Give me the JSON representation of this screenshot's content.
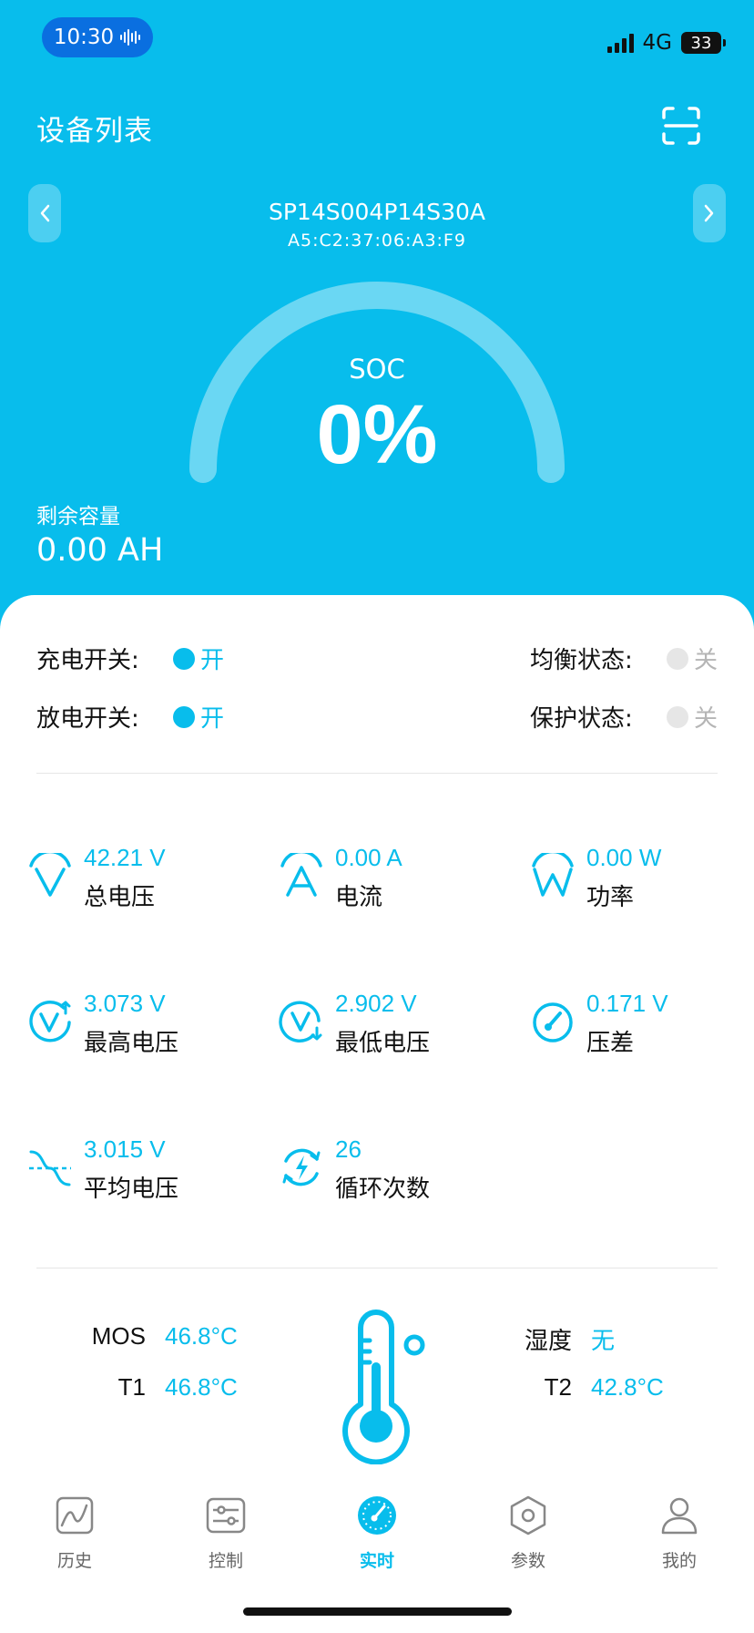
{
  "status_bar": {
    "time": "10:30",
    "network": "4G",
    "battery": "33"
  },
  "header": {
    "title": "设备列表",
    "device_name": "SP14S004P14S30A",
    "device_mac": "A5:C2:37:06:A3:F9"
  },
  "gauge": {
    "label": "SOC",
    "value": "0%",
    "fraction": 0
  },
  "capacity": {
    "label": "剩余容量",
    "value": "0.00 AH"
  },
  "switches": {
    "charge": {
      "label": "充电开关:",
      "state": "开"
    },
    "discharge": {
      "label": "放电开关:",
      "state": "开"
    },
    "balance": {
      "label": "均衡状态:",
      "state": "关"
    },
    "protect": {
      "label": "保护状态:",
      "state": "关"
    }
  },
  "metrics": {
    "total_voltage": {
      "value": "42.21 V",
      "label": "总电压"
    },
    "current": {
      "value": "0.00 A",
      "label": "电流"
    },
    "power": {
      "value": "0.00 W",
      "label": "功率"
    },
    "max_voltage": {
      "value": "3.073 V",
      "label": "最高电压"
    },
    "min_voltage": {
      "value": "2.902 V",
      "label": "最低电压"
    },
    "voltage_diff": {
      "value": "0.171 V",
      "label": "压差"
    },
    "avg_voltage": {
      "value": "3.015 V",
      "label": "平均电压"
    },
    "cycles": {
      "value": "26",
      "label": "循环次数"
    }
  },
  "temps": {
    "mos": {
      "label": "MOS",
      "value": "46.8°C"
    },
    "t1": {
      "label": "T1",
      "value": "46.8°C"
    },
    "humidity": {
      "label": "湿度",
      "value": "无"
    },
    "t2": {
      "label": "T2",
      "value": "42.8°C"
    }
  },
  "bottom_nav": [
    {
      "label": "历史",
      "icon": "history-chart-icon"
    },
    {
      "label": "控制",
      "icon": "control-sliders-icon"
    },
    {
      "label": "实时",
      "icon": "realtime-gauge-icon"
    },
    {
      "label": "参数",
      "icon": "params-hexagon-icon"
    },
    {
      "label": "我的",
      "icon": "user-icon"
    }
  ],
  "colors": {
    "accent": "#08bdec",
    "active_blue": "#0a6fe0",
    "off_gray": "#e6e6e6"
  }
}
